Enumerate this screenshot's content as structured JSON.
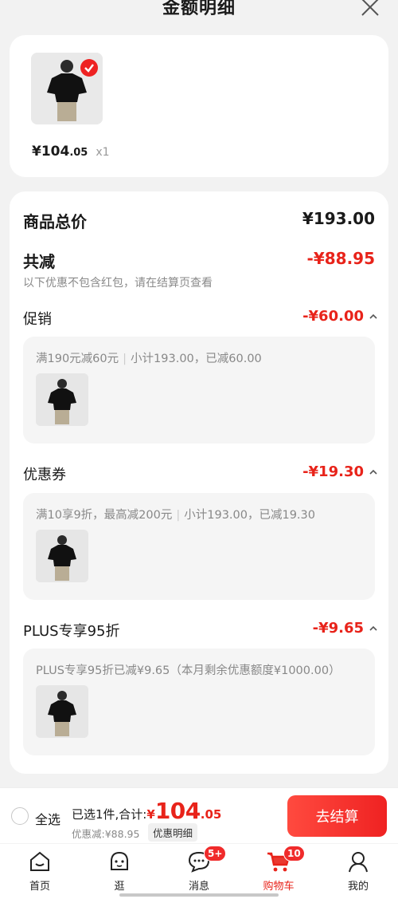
{
  "header": {
    "title": "金额明细"
  },
  "product": {
    "price_main": "¥104",
    "price_frac": ".05",
    "qty": "x1"
  },
  "detail": {
    "total_label": "商品总价",
    "total_value": "¥193.00",
    "reduce_label": "共减",
    "reduce_value": "-¥88.95",
    "note": "以下优惠不包含红包，请在结算页查看",
    "promo": {
      "label": "促销",
      "value": "-¥60.00",
      "rule": "满190元减60元",
      "summary": "小计193.00，已减60.00"
    },
    "coupon": {
      "label": "优惠券",
      "value": "-¥19.30",
      "rule": "满10享9折，最高减200元",
      "summary": "小计193.00，已减19.30"
    },
    "plus": {
      "label": "PLUS专享95折",
      "value": "-¥9.65",
      "rule": "PLUS专享95折已减¥9.65（本月剩余优惠额度¥1000.00）"
    }
  },
  "bottom": {
    "select_all": "全选",
    "selected_prefix": "已选1件,合计:",
    "total_symbol": "¥",
    "total_int": "104",
    "total_frac": ".05",
    "discount": "优惠减:¥88.95",
    "detail_btn": "优惠明细",
    "checkout": "去结算"
  },
  "tabs": [
    {
      "label": "首页",
      "icon": "home-icon"
    },
    {
      "label": "逛",
      "icon": "browse-face-icon"
    },
    {
      "label": "消息",
      "icon": "message-icon",
      "badge": "5+"
    },
    {
      "label": "购物车",
      "icon": "cart-icon",
      "badge": "10"
    },
    {
      "label": "我的",
      "icon": "profile-icon"
    }
  ],
  "colors": {
    "accent": "#e8231a",
    "card": "#ffffff",
    "background": "#f2f2f2"
  }
}
